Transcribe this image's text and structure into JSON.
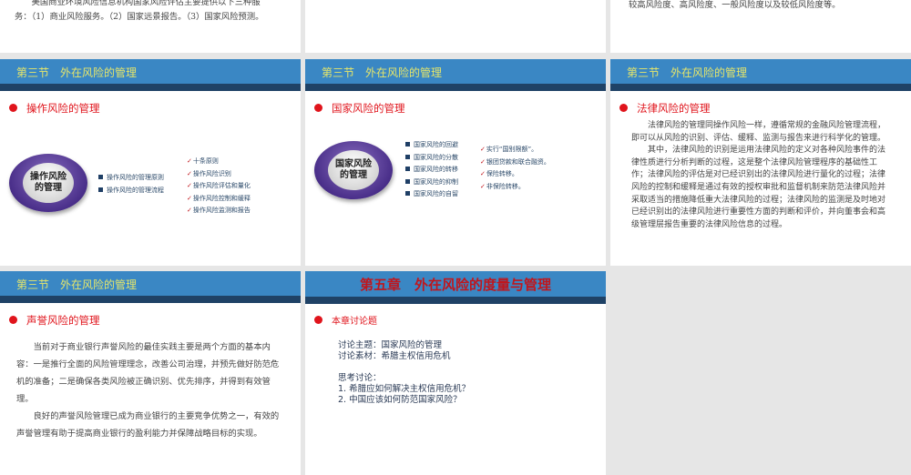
{
  "slides": [
    {
      "body": [
        "美国商业环境风险信息机构国家风险评估主要提供以下三种服务：（1）商业风险服务。（2）国家远景报告。（3）国家风险预测。"
      ]
    },
    {
      "body": []
    },
    {
      "body": [
        "较高风险度、高风险度、一般风险度以及较低风险度等。"
      ]
    },
    {
      "section_title": "第三节　外在风险的管理",
      "subtitle": "操作风险的管理",
      "oval_label": [
        "操作风险",
        "的管理"
      ],
      "items": [
        "操作风险的管理原则",
        "操作风险的管理流程"
      ],
      "checks": [
        "十条原则",
        "操作风险识别",
        "操作风险评估和量化",
        "操作风险控制和缓释",
        "操作风险监测和报告"
      ]
    },
    {
      "section_title": "第三节　外在风险的管理",
      "subtitle": "国家风险的管理",
      "oval_label": [
        "国家风险",
        "的管理"
      ],
      "items": [
        "国家风险的回避",
        "国家风险的分散",
        "国家风险的转移",
        "国家风险的抑制",
        "国家风险的自留"
      ],
      "checks": [
        "实行“国别限额”。",
        "银团贷款和联合融资。",
        "保险转移。",
        "非保险转移。"
      ]
    },
    {
      "section_title": "第三节　外在风险的管理",
      "subtitle": "法律风险的管理",
      "body": [
        "法律风险的管理同操作风险一样，遵循常规的金融风险管理流程，即可以从风险的识别、评估、缓释、监测与报告来进行科学化的管理。",
        "其中，法律风险的识别是运用法律风险的定义对各种风险事件的法律性质进行分析判断的过程，这是整个法律风险管理程序的基础性工作；法律风险的评估是对已经识别出的法律风险进行量化的过程；法律风险的控制和缓释是通过有效的授权审批和监督机制来防范法律风险并采取适当的措施降低重大法律风险的过程；法律风险的监测是及时地对已经识别出的法律风险进行重要性方面的判断和评价，并向董事会和高级管理层报告重要的法律风险信息的过程。"
      ]
    },
    {
      "section_title": "第三节　外在风险的管理",
      "subtitle": "声誉风险的管理",
      "body": [
        "当前对于商业银行声誉风险的最佳实践主要是两个方面的基本内容：一是推行全面的风险管理理念，改善公司治理，并预先做好防范危机的准备；二是确保各类风险被正确识别、优先排序，并得到有效管理。",
        "良好的声誉风险管理已成为商业银行的主要竞争优势之一，有效的声誉管理有助于提高商业银行的盈利能力并保障战略目标的实现。"
      ]
    },
    {
      "chapter_title": "第五章　外在风险的度量与管理",
      "subtitle": "本章讨论题",
      "topic": "讨论主题：国家风险的管理",
      "material": "讨论素材：希腊主权信用危机",
      "think_label": "思考讨论：",
      "questions": [
        "1. 希腊应如何解决主权信用危机？",
        "2. 中国应该如何防范国家风险？"
      ]
    }
  ]
}
